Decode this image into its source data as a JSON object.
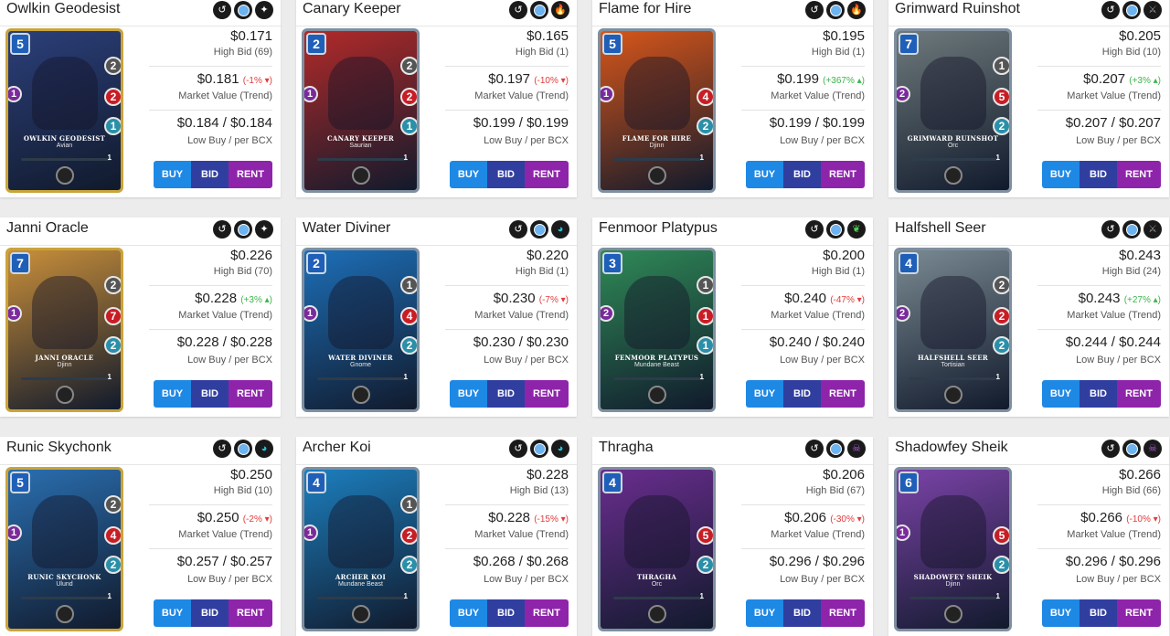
{
  "colors": {
    "buy": "#1e88e5",
    "bid": "#303f9f",
    "rent": "#8e24aa",
    "trend_up": "#3bb54a",
    "trend_down": "#e43b3b"
  },
  "cards": [
    {
      "title": "Owlkin Geodesist",
      "card_name": "OWLKIN GEODESIST",
      "race": "Avian",
      "mana": "5",
      "attack": "2",
      "health": "2",
      "speed": "1",
      "melee": "1",
      "level": "1",
      "high_bid_price": "$0.171",
      "high_bid_label": "High Bid (69)",
      "market_value": "$0.181",
      "trend": "(-1% ▾)",
      "trend_dir": "down",
      "market_label": "Market Value (Trend)",
      "low_buy": "$0.184 / $0.184",
      "low_buy_label": "Low Buy / per BCX",
      "element_icon": "gem-icon",
      "art_color": "#2b3f7a",
      "border_color": "#c9a43a",
      "buy": "BUY",
      "bid": "BID",
      "rent": "RENT"
    },
    {
      "title": "Canary Keeper",
      "card_name": "CANARY KEEPER",
      "race": "Saurian",
      "mana": "2",
      "attack": "2",
      "health": "2",
      "speed": "1",
      "melee": "1",
      "level": "1",
      "high_bid_price": "$0.165",
      "high_bid_label": "High Bid (1)",
      "market_value": "$0.197",
      "trend": "(-10% ▾)",
      "trend_dir": "down",
      "market_label": "Market Value (Trend)",
      "low_buy": "$0.199 / $0.199",
      "low_buy_label": "Low Buy / per BCX",
      "element_icon": "fire-icon",
      "art_color": "#b22a2a",
      "border_color": "#7f8fa0",
      "buy": "BUY",
      "bid": "BID",
      "rent": "RENT"
    },
    {
      "title": "Flame for Hire",
      "card_name": "FLAME FOR HIRE",
      "race": "Djinn",
      "mana": "5",
      "attack": "",
      "health": "4",
      "speed": "2",
      "melee": "1",
      "level": "1",
      "high_bid_price": "$0.195",
      "high_bid_label": "High Bid (1)",
      "market_value": "$0.199",
      "trend": "(+367% ▴)",
      "trend_dir": "up",
      "market_label": "Market Value (Trend)",
      "low_buy": "$0.199 / $0.199",
      "low_buy_label": "Low Buy / per BCX",
      "element_icon": "fire-icon",
      "art_color": "#d8561a",
      "border_color": "#7f8fa0",
      "buy": "BUY",
      "bid": "BID",
      "rent": "RENT"
    },
    {
      "title": "Grimward Ruinshot",
      "card_name": "GRIMWARD RUINSHOT",
      "race": "Orc",
      "mana": "7",
      "attack": "1",
      "health": "5",
      "speed": "2",
      "melee": "2",
      "level": "1",
      "high_bid_price": "$0.205",
      "high_bid_label": "High Bid (10)",
      "market_value": "$0.207",
      "trend": "(+3% ▴)",
      "trend_dir": "up",
      "market_label": "Market Value (Trend)",
      "low_buy": "$0.207 / $0.207",
      "low_buy_label": "Low Buy / per BCX",
      "element_icon": "swords-icon",
      "art_color": "#6e7a7c",
      "border_color": "#7f8fa0",
      "buy": "BUY",
      "bid": "BID",
      "rent": "RENT"
    },
    {
      "title": "Janni Oracle",
      "card_name": "JANNI ORACLE",
      "race": "Djinn",
      "mana": "7",
      "attack": "2",
      "health": "7",
      "speed": "2",
      "melee": "1",
      "level": "1",
      "high_bid_price": "$0.226",
      "high_bid_label": "High Bid (70)",
      "market_value": "$0.228",
      "trend": "(+3% ▴)",
      "trend_dir": "up",
      "market_label": "Market Value (Trend)",
      "low_buy": "$0.228 / $0.228",
      "low_buy_label": "Low Buy / per BCX",
      "element_icon": "gem-icon",
      "art_color": "#c98f3a",
      "border_color": "#c9a43a",
      "buy": "BUY",
      "bid": "BID",
      "rent": "RENT"
    },
    {
      "title": "Water Diviner",
      "card_name": "WATER DIVINER",
      "race": "Gnome",
      "mana": "2",
      "attack": "1",
      "health": "4",
      "speed": "2",
      "melee": "1",
      "level": "1",
      "high_bid_price": "$0.220",
      "high_bid_label": "High Bid (1)",
      "market_value": "$0.230",
      "trend": "(-7% ▾)",
      "trend_dir": "down",
      "market_label": "Market Value (Trend)",
      "low_buy": "$0.230 / $0.230",
      "low_buy_label": "Low Buy / per BCX",
      "element_icon": "water-icon",
      "art_color": "#1d6fb8",
      "border_color": "#7f8fa0",
      "buy": "BUY",
      "bid": "BID",
      "rent": "RENT"
    },
    {
      "title": "Fenmoor Platypus",
      "card_name": "FENMOOR PLATYPUS",
      "race": "Mundane Beast",
      "mana": "3",
      "attack": "1",
      "health": "1",
      "speed": "1",
      "melee": "2",
      "level": "1",
      "high_bid_price": "$0.200",
      "high_bid_label": "High Bid (1)",
      "market_value": "$0.240",
      "trend": "(-47% ▾)",
      "trend_dir": "down",
      "market_label": "Market Value (Trend)",
      "low_buy": "$0.240 / $0.240",
      "low_buy_label": "Low Buy / per BCX",
      "element_icon": "leaf-icon",
      "art_color": "#2f8a57",
      "border_color": "#7f8fa0",
      "buy": "BUY",
      "bid": "BID",
      "rent": "RENT"
    },
    {
      "title": "Halfshell Seer",
      "card_name": "HALFSHELL SEER",
      "race": "Tortisian",
      "mana": "4",
      "attack": "2",
      "health": "2",
      "speed": "2",
      "melee": "2",
      "level": "1",
      "high_bid_price": "$0.243",
      "high_bid_label": "High Bid (24)",
      "market_value": "$0.243",
      "trend": "(+27% ▴)",
      "trend_dir": "up",
      "market_label": "Market Value (Trend)",
      "low_buy": "$0.244 / $0.244",
      "low_buy_label": "Low Buy / per BCX",
      "element_icon": "swords-icon",
      "art_color": "#7a8a92",
      "border_color": "#7f8fa0",
      "buy": "BUY",
      "bid": "BID",
      "rent": "RENT"
    },
    {
      "title": "Runic Skychonk",
      "card_name": "RUNIC SKYCHONK",
      "race": "Ulund",
      "mana": "5",
      "attack": "2",
      "health": "4",
      "speed": "2",
      "melee": "1",
      "level": "1",
      "high_bid_price": "$0.250",
      "high_bid_label": "High Bid (10)",
      "market_value": "$0.250",
      "trend": "(-2% ▾)",
      "trend_dir": "down",
      "market_label": "Market Value (Trend)",
      "low_buy": "$0.257 / $0.257",
      "low_buy_label": "Low Buy / per BCX",
      "element_icon": "water-icon",
      "art_color": "#2a6fb0",
      "border_color": "#c9a43a",
      "buy": "BUY",
      "bid": "BID",
      "rent": "RENT"
    },
    {
      "title": "Archer Koi",
      "card_name": "ARCHER KOI",
      "race": "Mundane Beast",
      "mana": "4",
      "attack": "1",
      "health": "2",
      "speed": "2",
      "melee": "1",
      "level": "1",
      "high_bid_price": "$0.228",
      "high_bid_label": "High Bid (13)",
      "market_value": "$0.228",
      "trend": "(-15% ▾)",
      "trend_dir": "down",
      "market_label": "Market Value (Trend)",
      "low_buy": "$0.268 / $0.268",
      "low_buy_label": "Low Buy / per BCX",
      "element_icon": "water-icon",
      "art_color": "#1c7fbf",
      "border_color": "#7f8fa0",
      "buy": "BUY",
      "bid": "BID",
      "rent": "RENT"
    },
    {
      "title": "Thragha",
      "card_name": "THRAGHA",
      "race": "Orc",
      "mana": "4",
      "attack": "",
      "health": "5",
      "speed": "2",
      "melee": "",
      "level": "1",
      "high_bid_price": "$0.206",
      "high_bid_label": "High Bid (67)",
      "market_value": "$0.206",
      "trend": "(-30% ▾)",
      "trend_dir": "down",
      "market_label": "Market Value (Trend)",
      "low_buy": "$0.296 / $0.296",
      "low_buy_label": "Low Buy / per BCX",
      "element_icon": "death-icon",
      "art_color": "#6a2d8f",
      "border_color": "#7f8fa0",
      "buy": "BUY",
      "bid": "BID",
      "rent": "RENT"
    },
    {
      "title": "Shadowfey Sheik",
      "card_name": "SHADOWFEY SHEIK",
      "race": "Djinn",
      "mana": "6",
      "attack": "",
      "health": "5",
      "speed": "2",
      "melee": "1",
      "level": "1",
      "high_bid_price": "$0.266",
      "high_bid_label": "High Bid (66)",
      "market_value": "$0.266",
      "trend": "(-10% ▾)",
      "trend_dir": "down",
      "market_label": "Market Value (Trend)",
      "low_buy": "$0.296 / $0.296",
      "low_buy_label": "Low Buy / per BCX",
      "element_icon": "death-icon",
      "art_color": "#7b43a8",
      "border_color": "#7f8fa0",
      "buy": "BUY",
      "bid": "BID",
      "rent": "RENT"
    }
  ]
}
